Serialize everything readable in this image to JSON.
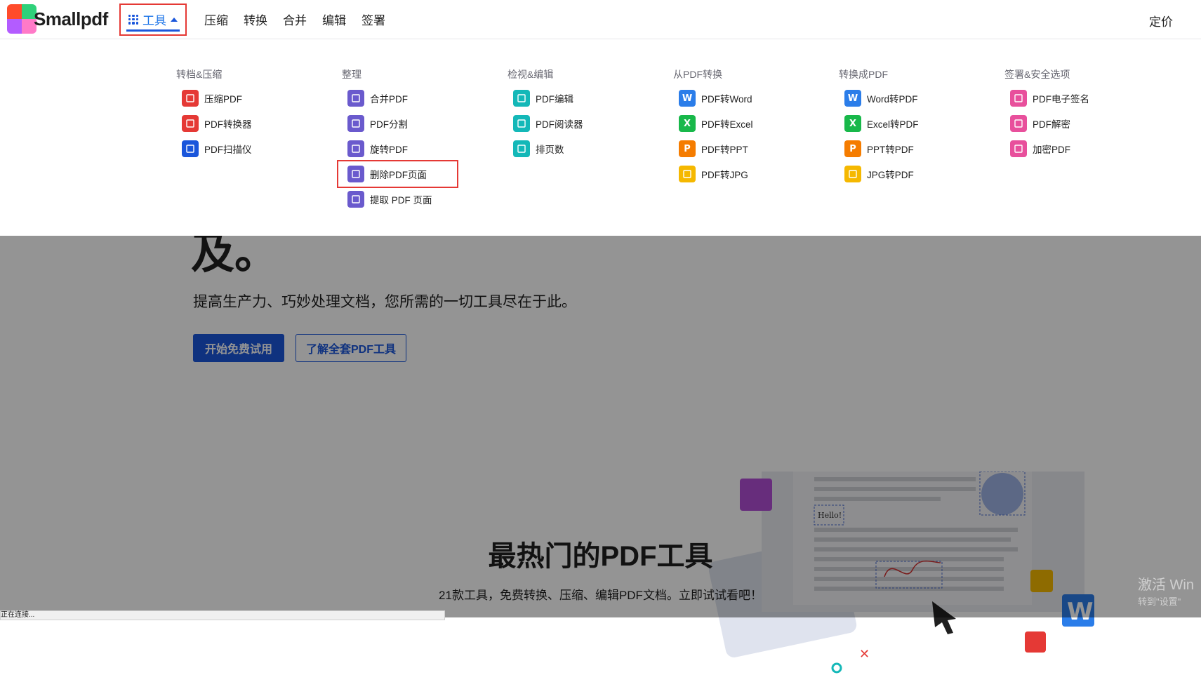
{
  "header": {
    "logo_text": "Smallpdf",
    "nav": {
      "tools_label": "工具",
      "items": [
        "压缩",
        "转换",
        "合并",
        "编辑",
        "签署"
      ]
    },
    "pricing_label": "定价"
  },
  "dropdown": {
    "columns": [
      {
        "title": "转档&压缩",
        "tools": [
          {
            "label": "压缩PDF",
            "icon": "compress-icon",
            "color": "#e53935"
          },
          {
            "label": "PDF转换器",
            "icon": "convert-icon",
            "color": "#e53935"
          },
          {
            "label": "PDF扫描仪",
            "icon": "camera-icon",
            "color": "#1a56db"
          }
        ]
      },
      {
        "title": "整理",
        "tools": [
          {
            "label": "合并PDF",
            "icon": "merge-icon",
            "color": "#6a5acd"
          },
          {
            "label": "PDF分割",
            "icon": "scissors-icon",
            "color": "#6a5acd"
          },
          {
            "label": "旋转PDF",
            "icon": "rotate-icon",
            "color": "#6a5acd"
          },
          {
            "label": "删除PDF页面",
            "icon": "trash-icon",
            "color": "#6a5acd"
          },
          {
            "label": "提取 PDF 页面",
            "icon": "extract-icon",
            "color": "#6a5acd"
          }
        ]
      },
      {
        "title": "检视&编辑",
        "tools": [
          {
            "label": "PDF编辑",
            "icon": "text-edit-icon",
            "color": "#14b8b8"
          },
          {
            "label": "PDF阅读器",
            "icon": "reader-icon",
            "color": "#14b8b8"
          },
          {
            "label": "排页数",
            "icon": "page-number-icon",
            "color": "#14b8b8"
          }
        ]
      },
      {
        "title": "从PDF转换",
        "tools": [
          {
            "label": "PDF转Word",
            "icon": "word-icon",
            "color": "#2b7de9",
            "glyph": "W"
          },
          {
            "label": "PDF转Excel",
            "icon": "excel-icon",
            "color": "#18b84a",
            "glyph": "X"
          },
          {
            "label": "PDF转PPT",
            "icon": "ppt-icon",
            "color": "#f57c00",
            "glyph": "P"
          },
          {
            "label": "PDF转JPG",
            "icon": "image-icon",
            "color": "#f5b800"
          }
        ]
      },
      {
        "title": "转换成PDF",
        "tools": [
          {
            "label": "Word转PDF",
            "icon": "word-icon",
            "color": "#2b7de9",
            "glyph": "W"
          },
          {
            "label": "Excel转PDF",
            "icon": "excel-icon",
            "color": "#18b84a",
            "glyph": "X"
          },
          {
            "label": "PPT转PDF",
            "icon": "ppt-icon",
            "color": "#f57c00",
            "glyph": "P"
          },
          {
            "label": "JPG转PDF",
            "icon": "image-icon",
            "color": "#f5b800"
          }
        ]
      },
      {
        "title": "签署&安全选项",
        "tools": [
          {
            "label": "PDF电子签名",
            "icon": "signature-icon",
            "color": "#e8509c"
          },
          {
            "label": "PDF解密",
            "icon": "unlock-icon",
            "color": "#e8509c"
          },
          {
            "label": "加密PDF",
            "icon": "lock-icon",
            "color": "#e8509c"
          }
        ]
      }
    ]
  },
  "hero": {
    "big_text": "及。",
    "subtitle": "提高生产力、巧妙处理文档，您所需的一切工具尽在于此。",
    "primary_button": "开始免费试用",
    "secondary_button": "了解全套PDF工具",
    "illustration_hello": "Hello!"
  },
  "section": {
    "title": "最热门的PDF工具",
    "subtitle": "21款工具，免费转换、压缩、编辑PDF文档。立即试试看吧！"
  },
  "watermark": {
    "line1": "激活 Win",
    "line2": "转到\"设置\""
  },
  "statusbar": {
    "text": "正在连接..."
  }
}
